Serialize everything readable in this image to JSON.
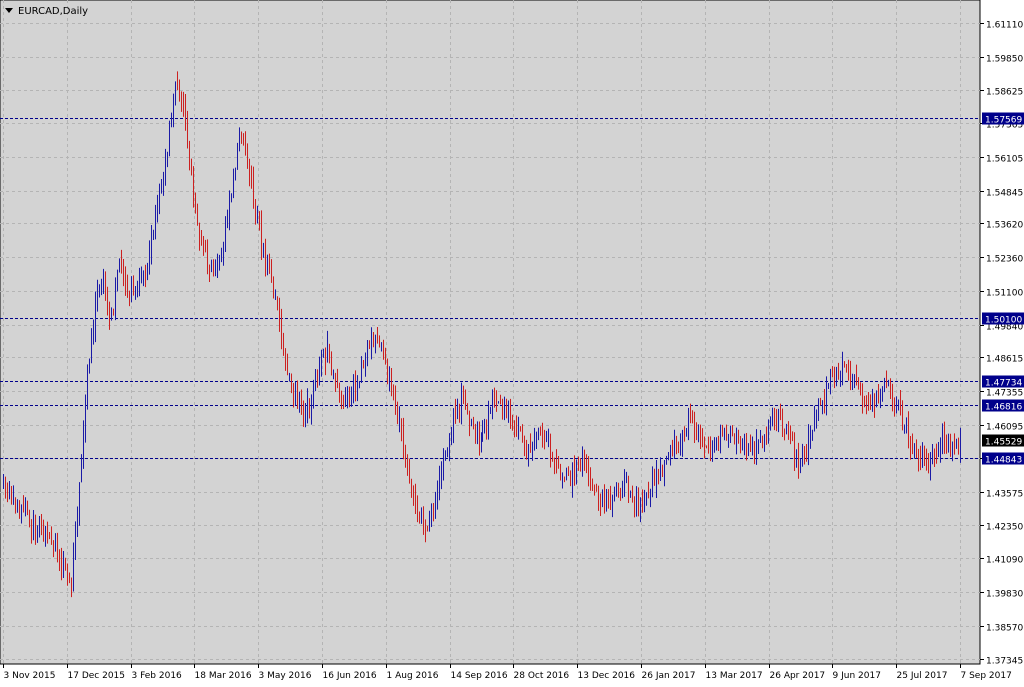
{
  "window": {
    "title": "EURCAD,Daily",
    "title_icon": "triangle-down-icon",
    "colors": {
      "plot_bg": "#d3d3d3",
      "outer_bg": "#ffffff",
      "grid": "#b4b4b4",
      "bull": "#1a1aa6",
      "bear": "#cc2020",
      "hline": "#00008b",
      "label_bg": "#00008b",
      "label_text": "#ffffff",
      "price_bg": "#000000",
      "price_text": "#ffffff"
    }
  },
  "chart_data": {
    "type": "ohlc",
    "symbol": "EURCAD",
    "timeframe": "Daily",
    "ylim": [
      1.3714,
      1.6198
    ],
    "grid": true,
    "y_ticks": [
      "1.61110",
      "1.59850",
      "1.58625",
      "1.57365",
      "1.56105",
      "1.54845",
      "1.53620",
      "1.52360",
      "1.51100",
      "1.49840",
      "1.48615",
      "1.47355",
      "1.46095",
      "1.44835",
      "1.43575",
      "1.42350",
      "1.41090",
      "1.39830",
      "1.38570",
      "1.37345"
    ],
    "x_ticks": [
      "3 Nov 2015",
      "17 Dec 2015",
      "3 Feb 2016",
      "18 Mar 2016",
      "3 May 2016",
      "16 Jun 2016",
      "1 Aug 2016",
      "14 Sep 2016",
      "28 Oct 2016",
      "13 Dec 2016",
      "26 Jan 2017",
      "13 Mar 2017",
      "26 Apr 2017",
      "9 Jun 2017",
      "25 Jul 2017",
      "7 Sep 2017"
    ],
    "horizontal_lines": [
      "1.57569",
      "1.50100",
      "1.47734",
      "1.46816",
      "1.44843"
    ],
    "current_price": "1.45529",
    "bar_count": 480,
    "path_points": [
      [
        0,
        1.438
      ],
      [
        12,
        1.425
      ],
      [
        24,
        1.418
      ],
      [
        30,
        1.408
      ],
      [
        34,
        1.402
      ],
      [
        38,
        1.438
      ],
      [
        42,
        1.48
      ],
      [
        46,
        1.505
      ],
      [
        50,
        1.515
      ],
      [
        54,
        1.5
      ],
      [
        58,
        1.522
      ],
      [
        62,
        1.51
      ],
      [
        66,
        1.515
      ],
      [
        70,
        1.515
      ],
      [
        74,
        1.528
      ],
      [
        78,
        1.545
      ],
      [
        82,
        1.565
      ],
      [
        86,
        1.588
      ],
      [
        90,
        1.578
      ],
      [
        94,
        1.552
      ],
      [
        98,
        1.532
      ],
      [
        102,
        1.522
      ],
      [
        106,
        1.518
      ],
      [
        110,
        1.53
      ],
      [
        114,
        1.548
      ],
      [
        118,
        1.57
      ],
      [
        122,
        1.562
      ],
      [
        126,
        1.542
      ],
      [
        130,
        1.525
      ],
      [
        134,
        1.515
      ],
      [
        138,
        1.498
      ],
      [
        142,
        1.48
      ],
      [
        146,
        1.47
      ],
      [
        150,
        1.465
      ],
      [
        154,
        1.47
      ],
      [
        158,
        1.485
      ],
      [
        162,
        1.488
      ],
      [
        166,
        1.475
      ],
      [
        170,
        1.468
      ],
      [
        174,
        1.472
      ],
      [
        178,
        1.478
      ],
      [
        182,
        1.49
      ],
      [
        186,
        1.493
      ],
      [
        190,
        1.485
      ],
      [
        194,
        1.475
      ],
      [
        198,
        1.46
      ],
      [
        202,
        1.445
      ],
      [
        206,
        1.432
      ],
      [
        210,
        1.422
      ],
      [
        214,
        1.425
      ],
      [
        218,
        1.438
      ],
      [
        222,
        1.452
      ],
      [
        226,
        1.468
      ],
      [
        230,
        1.47
      ],
      [
        234,
        1.462
      ],
      [
        238,
        1.455
      ],
      [
        242,
        1.462
      ],
      [
        246,
        1.468
      ],
      [
        250,
        1.47
      ],
      [
        254,
        1.466
      ],
      [
        258,
        1.458
      ],
      [
        262,
        1.452
      ],
      [
        266,
        1.455
      ],
      [
        270,
        1.458
      ],
      [
        274,
        1.452
      ],
      [
        278,
        1.445
      ],
      [
        282,
        1.44
      ],
      [
        286,
        1.442
      ],
      [
        290,
        1.448
      ],
      [
        294,
        1.44
      ],
      [
        298,
        1.435
      ],
      [
        302,
        1.432
      ],
      [
        306,
        1.435
      ],
      [
        310,
        1.44
      ],
      [
        314,
        1.436
      ],
      [
        318,
        1.432
      ],
      [
        322,
        1.436
      ],
      [
        326,
        1.44
      ],
      [
        330,
        1.445
      ],
      [
        334,
        1.45
      ],
      [
        338,
        1.455
      ],
      [
        342,
        1.462
      ],
      [
        346,
        1.46
      ],
      [
        350,
        1.455
      ],
      [
        354,
        1.452
      ],
      [
        358,
        1.455
      ],
      [
        362,
        1.458
      ],
      [
        366,
        1.456
      ],
      [
        370,
        1.452
      ],
      [
        374,
        1.45
      ],
      [
        378,
        1.455
      ],
      [
        382,
        1.46
      ],
      [
        386,
        1.465
      ],
      [
        390,
        1.462
      ],
      [
        394,
        1.458
      ],
      [
        398,
        1.445
      ],
      [
        402,
        1.45
      ],
      [
        406,
        1.462
      ],
      [
        410,
        1.47
      ],
      [
        414,
        1.478
      ],
      [
        418,
        1.482
      ],
      [
        422,
        1.48
      ],
      [
        426,
        1.478
      ],
      [
        430,
        1.47
      ],
      [
        434,
        1.465
      ],
      [
        438,
        1.472
      ],
      [
        442,
        1.478
      ],
      [
        446,
        1.47
      ],
      [
        450,
        1.462
      ],
      [
        454,
        1.455
      ],
      [
        458,
        1.45
      ],
      [
        462,
        1.445
      ],
      [
        466,
        1.452
      ],
      [
        470,
        1.455
      ],
      [
        474,
        1.452
      ],
      [
        478,
        1.455
      ],
      [
        479,
        1.455
      ]
    ]
  }
}
